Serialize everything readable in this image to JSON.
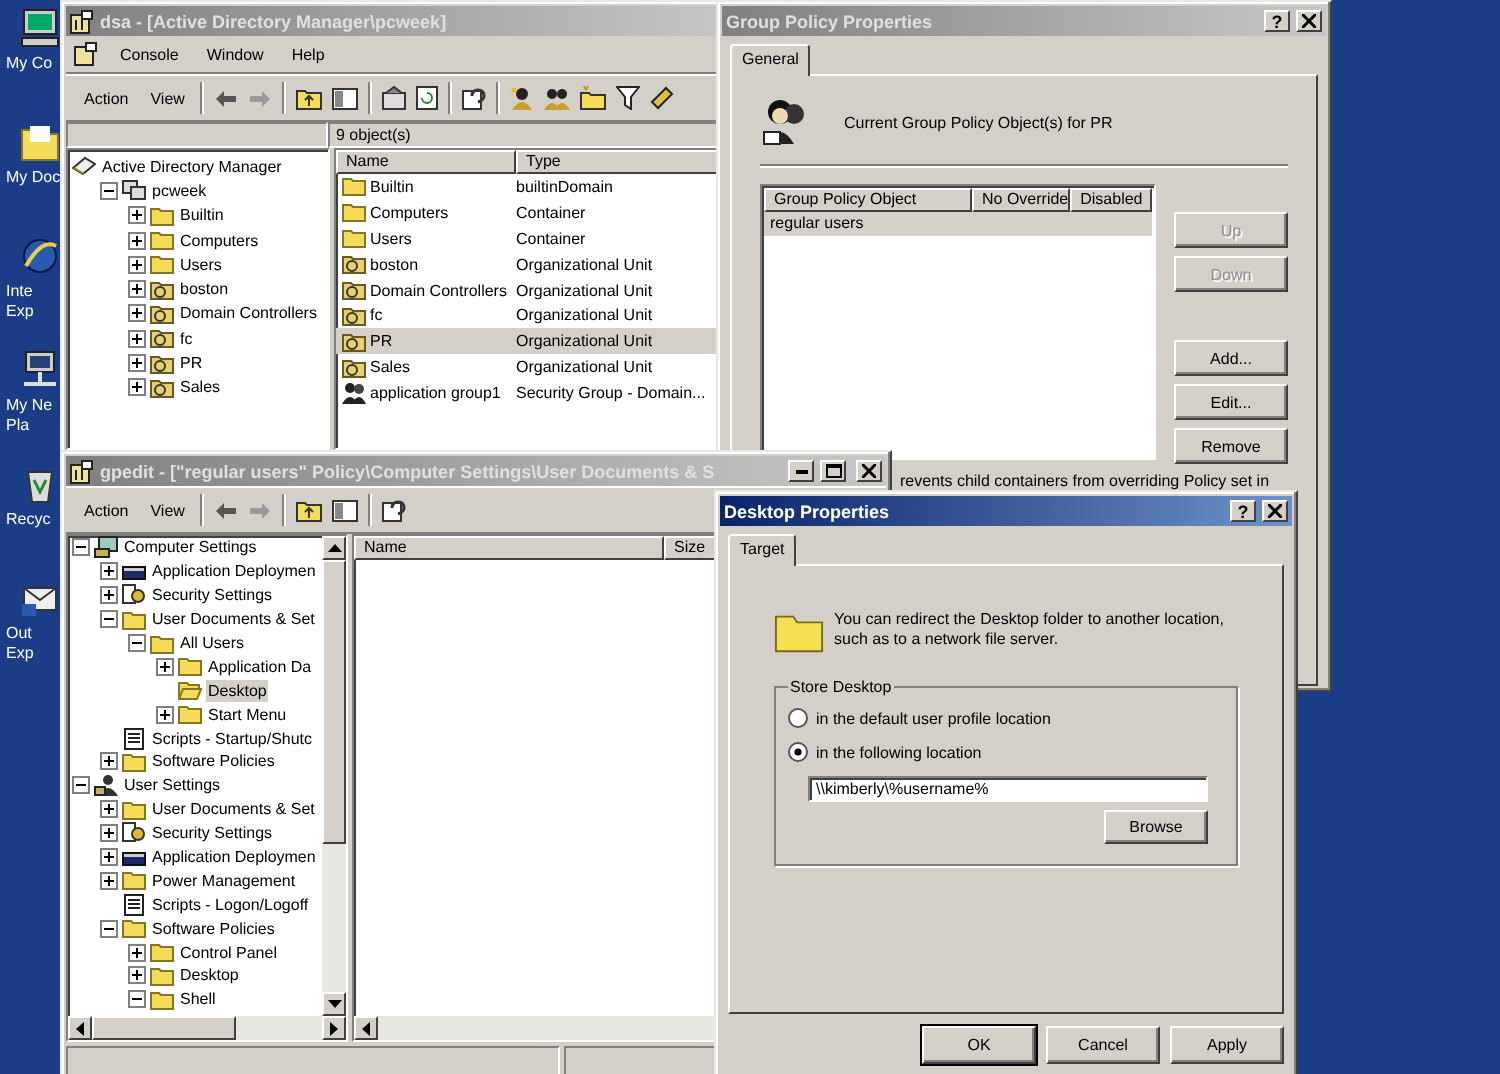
{
  "desktop_icons": [
    {
      "kind": "computer",
      "lines": [
        "My Co"
      ]
    },
    {
      "kind": "documents",
      "lines": [
        "My Doc"
      ]
    },
    {
      "kind": "browser",
      "lines": [
        "Inte",
        "Exp"
      ]
    },
    {
      "kind": "network",
      "lines": [
        "My Ne",
        "Pla"
      ]
    },
    {
      "kind": "recycle",
      "lines": [
        "Recyc"
      ]
    },
    {
      "kind": "mail",
      "lines": [
        "Out",
        "Exp"
      ]
    }
  ],
  "dsa": {
    "title": "dsa - [Active Directory Manager\\pcweek]",
    "active": false,
    "menu": [
      "Console",
      "Window",
      "Help"
    ],
    "toolbar": [
      "Action",
      "View"
    ],
    "status": "9 object(s)",
    "tree": [
      {
        "label": "Active Directory Manager",
        "kind": "root",
        "selected": false,
        "children": [
          {
            "label": "pcweek",
            "kind": "domain",
            "expanded": true,
            "selected": false,
            "children": [
              {
                "label": "Builtin",
                "kind": "folder",
                "expanded": false,
                "selected": false
              },
              {
                "label": "Computers",
                "kind": "folder",
                "expanded": false,
                "selected": false
              },
              {
                "label": "Users",
                "kind": "folder",
                "expanded": false,
                "selected": false
              },
              {
                "label": "boston",
                "kind": "unit",
                "expanded": false,
                "selected": false
              },
              {
                "label": "Domain Controllers",
                "kind": "unit",
                "expanded": false,
                "selected": false
              },
              {
                "label": "fc",
                "kind": "unit",
                "expanded": false,
                "selected": false
              },
              {
                "label": "PR",
                "kind": "unit",
                "expanded": false,
                "selected": false
              },
              {
                "label": "Sales",
                "kind": "unit",
                "expanded": false,
                "selected": false
              }
            ]
          }
        ]
      }
    ],
    "columns": [
      "Name",
      "Type"
    ],
    "rows": [
      {
        "name": "Builtin",
        "type": "builtinDomain",
        "kind": "folder",
        "selected": false
      },
      {
        "name": "Computers",
        "type": "Container",
        "kind": "folder",
        "selected": false
      },
      {
        "name": "Users",
        "type": "Container",
        "kind": "folder",
        "selected": false
      },
      {
        "name": "boston",
        "type": "Organizational Unit",
        "kind": "unit",
        "selected": false
      },
      {
        "name": "Domain Controllers",
        "type": "Organizational Unit",
        "kind": "unit",
        "selected": false
      },
      {
        "name": "fc",
        "type": "Organizational Unit",
        "kind": "unit",
        "selected": false
      },
      {
        "name": "PR",
        "type": "Organizational Unit",
        "kind": "unit",
        "selected": true
      },
      {
        "name": "Sales",
        "type": "Organizational Unit",
        "kind": "unit",
        "selected": false
      },
      {
        "name": "application group1",
        "type": "Security Group - Domain...",
        "kind": "group",
        "selected": false
      }
    ]
  },
  "group_policy": {
    "title": "Group Policy Properties",
    "active": false,
    "help": "?",
    "tabs": [
      {
        "label": "General",
        "selected": true
      }
    ],
    "heading": "Current Group Policy Object(s) for PR",
    "columns": [
      "Group Policy Object",
      "No Override",
      "Disabled"
    ],
    "rows": [
      {
        "name": "regular users",
        "selected": true
      }
    ],
    "buttons": [
      {
        "label": "Up",
        "disabled": true
      },
      {
        "label": "Down",
        "disabled": true
      },
      {
        "label": "Add...",
        "disabled": false
      },
      {
        "label": "Edit...",
        "disabled": false
      },
      {
        "label": "Remove",
        "disabled": false
      }
    ],
    "note": "revents child containers from overriding Policy set in"
  },
  "gpedit": {
    "title": "gpedit - [\"regular users\" Policy\\Computer Settings\\User Documents & S",
    "active": false,
    "toolbar": [
      "Action",
      "View"
    ],
    "tree": [
      {
        "label": "Computer Settings",
        "kind": "computer",
        "expanded": true,
        "selected": false,
        "children": [
          {
            "label": "Application Deploymen",
            "kind": "package",
            "expanded": false,
            "selected": false
          },
          {
            "label": "Security Settings",
            "kind": "security",
            "expanded": false,
            "selected": false
          },
          {
            "label": "User Documents & Set",
            "kind": "folder",
            "expanded": true,
            "selected": false,
            "children": [
              {
                "label": "All Users",
                "kind": "folder",
                "expanded": true,
                "selected": false,
                "children": [
                  {
                    "label": "Application Da",
                    "kind": "folder",
                    "expanded": false,
                    "selected": false
                  },
                  {
                    "label": "Desktop",
                    "kind": "openfolder",
                    "selected": true
                  },
                  {
                    "label": "Start Menu",
                    "kind": "folder",
                    "expanded": false,
                    "selected": false
                  }
                ]
              }
            ]
          },
          {
            "label": "Scripts - Startup/Shutc",
            "kind": "script",
            "selected": false
          },
          {
            "label": "Software Policies",
            "kind": "folder",
            "expanded": false,
            "selected": false
          }
        ]
      },
      {
        "label": "User Settings",
        "kind": "user",
        "expanded": true,
        "selected": false,
        "children": [
          {
            "label": "User Documents & Set",
            "kind": "folder",
            "expanded": false,
            "selected": false
          },
          {
            "label": "Security Settings",
            "kind": "security",
            "expanded": false,
            "selected": false
          },
          {
            "label": "Application Deploymen",
            "kind": "package",
            "expanded": false,
            "selected": false
          },
          {
            "label": "Power Management",
            "kind": "folder",
            "expanded": false,
            "selected": false
          },
          {
            "label": "Scripts - Logon/Logoff",
            "kind": "script",
            "selected": false
          },
          {
            "label": "Software Policies",
            "kind": "folder",
            "expanded": true,
            "selected": false,
            "children": [
              {
                "label": "Control Panel",
                "kind": "folder",
                "expanded": false,
                "selected": false
              },
              {
                "label": "Desktop",
                "kind": "folder",
                "expanded": false,
                "selected": false
              },
              {
                "label": "Shell",
                "kind": "folder",
                "expanded": true,
                "selected": false
              }
            ]
          }
        ]
      }
    ],
    "columns": [
      "Name",
      "Size"
    ]
  },
  "desktop_properties": {
    "title": "Desktop Properties",
    "active": true,
    "help": "?",
    "tabs": [
      {
        "label": "Target",
        "selected": true
      }
    ],
    "description": "You can redirect the Desktop folder to another location, such as to a network file server.",
    "group": "Store Desktop",
    "options": [
      {
        "label": "in the default user profile location",
        "selected": false
      },
      {
        "label": "in the following location",
        "selected": true
      }
    ],
    "path": "\\\\kimberly\\%username%",
    "browse": "Browse",
    "buttons": [
      "OK",
      "Cancel",
      "Apply"
    ]
  }
}
